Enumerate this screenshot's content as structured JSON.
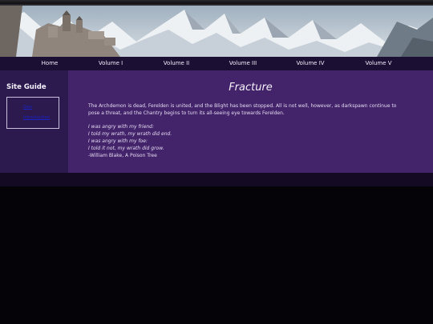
{
  "nav": {
    "items": [
      {
        "label": "Home"
      },
      {
        "label": "Volume I"
      },
      {
        "label": "Volume II"
      },
      {
        "label": "Volume III"
      },
      {
        "label": "Volume IV"
      },
      {
        "label": "Volume V"
      }
    ]
  },
  "sidebar": {
    "title": "Site Guide",
    "links": [
      {
        "label": "Gen"
      },
      {
        "label": "Introduction"
      }
    ]
  },
  "main": {
    "title": "Fracture",
    "intro": "The Archdemon is dead, Ferelden is united, and the Blight has been stopped. All is not well, however, as darkspawn continue to pose a threat, and the Chantry begins to turn its all-seeing eye towards Ferelden.",
    "poem_lines": [
      "I was angry with my friend:",
      "I told my wrath, my wrath did end.",
      "I was angry with my foe:",
      "I told it not, my wrath did grow."
    ],
    "attribution": "-William Blake, A Poison Tree"
  },
  "colors": {
    "navbar": "#1b0f33",
    "sidebar": "#2c1a4f",
    "content": "#432369",
    "background": "#050308",
    "link": "#1a22c8"
  }
}
